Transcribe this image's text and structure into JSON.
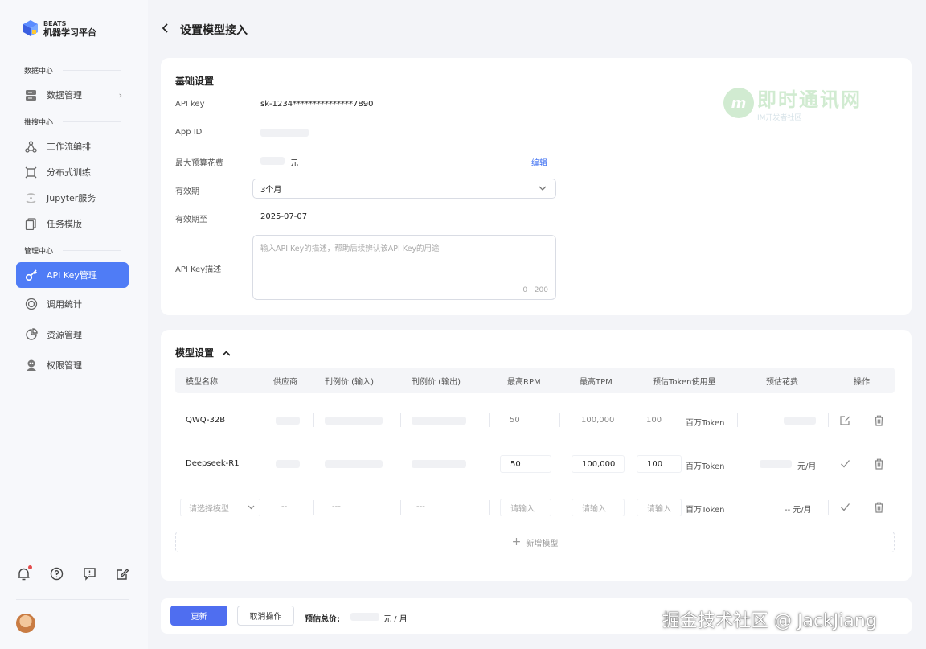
{
  "app": {
    "brand_top": "BEATS",
    "brand_name": "机器学习平台"
  },
  "sidebar": {
    "sections": [
      {
        "label": "数据中心"
      },
      {
        "label": "推搜中心"
      },
      {
        "label": "管理中心"
      }
    ],
    "items": [
      {
        "label": "数据管理",
        "icon": "database-icon"
      },
      {
        "label": "工作流编排",
        "icon": "workflow-icon"
      },
      {
        "label": "分布式训练",
        "icon": "chip-icon"
      },
      {
        "label": "Jupyter服务",
        "icon": "jupyter-icon"
      },
      {
        "label": "任务模版",
        "icon": "copy-icon"
      },
      {
        "label": "API Key管理",
        "icon": "key-icon",
        "active": true
      },
      {
        "label": "调用统计",
        "icon": "stats-icon"
      },
      {
        "label": "资源管理",
        "icon": "pie-icon"
      },
      {
        "label": "权限管理",
        "icon": "user-group-icon"
      }
    ]
  },
  "page": {
    "title": "设置模型接入"
  },
  "basic": {
    "heading": "基础设置",
    "api_key_label": "API key",
    "api_key_value": "sk-1234***************7890",
    "app_id_label": "App ID",
    "budget_label": "最大预算花费",
    "budget_unit": "元",
    "edit_label": "编辑",
    "validity_label": "有效期",
    "validity_value": "3个月",
    "expire_label": "有效期至",
    "expire_value": "2025-07-07",
    "desc_label": "API Key描述",
    "desc_placeholder": "输入API Key的描述，帮助后续辨认该API Key的用途",
    "desc_count": "0 | 200"
  },
  "watermark": {
    "logo": "m",
    "title": "即时通讯网",
    "sub": "IM开发者社区"
  },
  "models": {
    "heading": "模型设置",
    "columns": [
      "模型名称",
      "供应商",
      "刊例价 (输入)",
      "刊例价 (输出)",
      "最高RPM",
      "最高TPM",
      "预估Token使用量",
      "预估花费",
      "操作"
    ],
    "rows": [
      {
        "name": "QWQ-32B",
        "rpm": "50",
        "tpm": "100,000",
        "tokens": "100",
        "token_unit": "百万Token",
        "cost": ""
      },
      {
        "name": "Deepseek-R1",
        "rpm": "50",
        "tpm": "100,000",
        "tokens": "100",
        "token_unit": "百万Token",
        "cost": "元/月"
      }
    ],
    "new_row": {
      "select_placeholder": "请选择模型",
      "vendor": "--",
      "price_in": "---",
      "price_out": "---",
      "input_placeholder": "请输入",
      "token_unit": "百万Token",
      "cost": "-- 元/月"
    },
    "add_label": "新增模型"
  },
  "footer": {
    "update": "更新",
    "cancel": "取消操作",
    "total_label": "预估总价:",
    "total_unit": "元 / 月"
  },
  "credit": "掘金技术社区 @ JackJiang",
  "colors": {
    "accent": "#4f7cf6",
    "link": "#3d6ff2",
    "bg": "#f3f4f8"
  }
}
